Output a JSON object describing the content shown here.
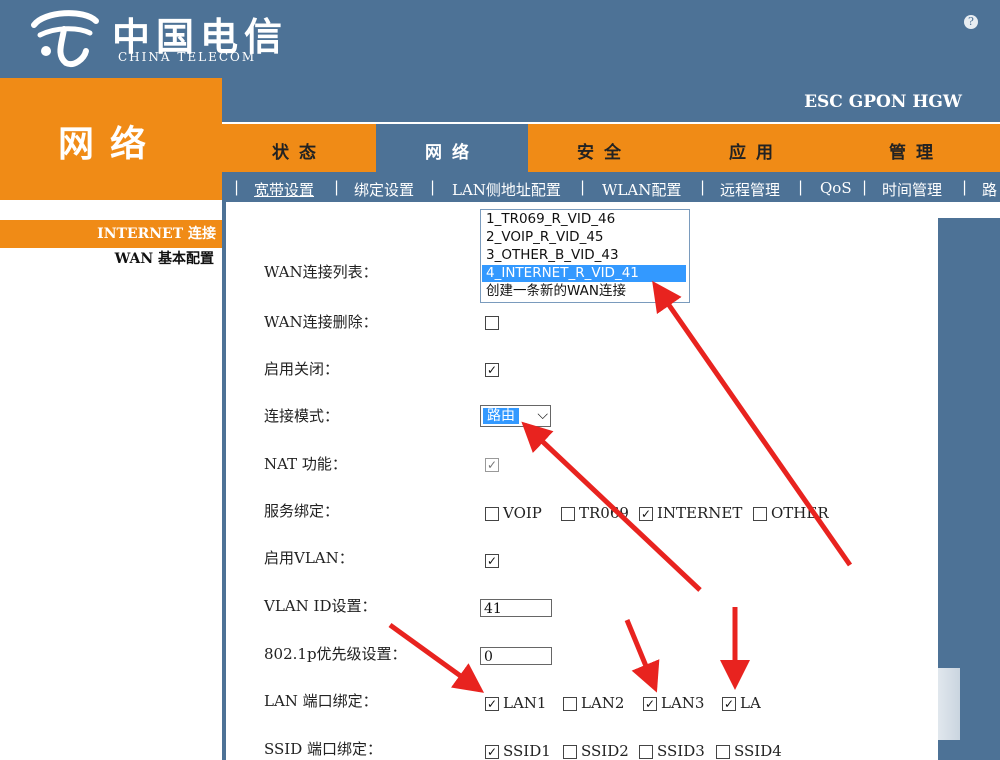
{
  "header": {
    "logo_cn": "中国电信",
    "logo_en": "CHINA TELECOM",
    "device_name": "ESC GPON HGW",
    "section_title": "网络"
  },
  "tabs": [
    {
      "label": "状态",
      "active": false
    },
    {
      "label": "网络",
      "active": true
    },
    {
      "label": "安全",
      "active": false
    },
    {
      "label": "应用",
      "active": false
    },
    {
      "label": "管理",
      "active": false
    }
  ],
  "subnav": [
    {
      "label": "宽带设置",
      "active": true
    },
    {
      "label": "绑定设置",
      "active": false
    },
    {
      "label": "LAN侧地址配置",
      "active": false
    },
    {
      "label": "WLAN配置",
      "active": false
    },
    {
      "label": "远程管理",
      "active": false
    },
    {
      "label": "QoS",
      "active": false
    },
    {
      "label": "时间管理",
      "active": false
    },
    {
      "label": "路",
      "active": false
    }
  ],
  "sidebar": {
    "active_item": "INTERNET 连接",
    "items": [
      "WAN 基本配置"
    ]
  },
  "form": {
    "wan_list_label": "WAN连接列表：",
    "wan_options": [
      "1_TR069_R_VID_46",
      "2_VOIP_R_VID_45",
      "3_OTHER_B_VID_43",
      "4_INTERNET_R_VID_41",
      "创建一条新的WAN连接"
    ],
    "wan_selected_index": 3,
    "delete_label": "WAN连接删除：",
    "delete_checked": false,
    "enable_label": "启用关闭：",
    "enable_checked": true,
    "mode_label": "连接模式：",
    "mode_value": "路由",
    "nat_label": "NAT 功能：",
    "nat_checked": true,
    "service_label": "服务绑定：",
    "services": [
      {
        "label": "VOIP",
        "checked": false
      },
      {
        "label": "TR069",
        "checked": false
      },
      {
        "label": "INTERNET",
        "checked": true
      },
      {
        "label": "OTHER",
        "checked": false
      }
    ],
    "vlan_enable_label": "启用VLAN：",
    "vlan_enable_checked": true,
    "vlan_id_label": "VLAN ID设置：",
    "vlan_id_value": "41",
    "priority_label": "802.1p优先级设置：",
    "priority_value": "0",
    "lan_bind_label": "LAN 端口绑定：",
    "lan_ports": [
      {
        "label": "LAN1",
        "checked": true
      },
      {
        "label": "LAN2",
        "checked": false
      },
      {
        "label": "LAN3",
        "checked": true
      },
      {
        "label": "LA",
        "checked": true
      }
    ],
    "ssid_bind_label": "SSID 端口绑定：",
    "ssids": [
      {
        "label": "SSID1",
        "checked": true
      },
      {
        "label": "SSID2",
        "checked": false
      },
      {
        "label": "SSID3",
        "checked": false
      },
      {
        "label": "SSID4",
        "checked": false
      }
    ]
  },
  "colors": {
    "header_blue": "#4d7296",
    "accent_orange": "#f08b16",
    "selection_blue": "#3399ff",
    "annotation_red": "#e8231f"
  },
  "icons": [
    "china-telecom-logo-icon",
    "help-icon",
    "chevron-down-icon",
    "check-icon"
  ]
}
